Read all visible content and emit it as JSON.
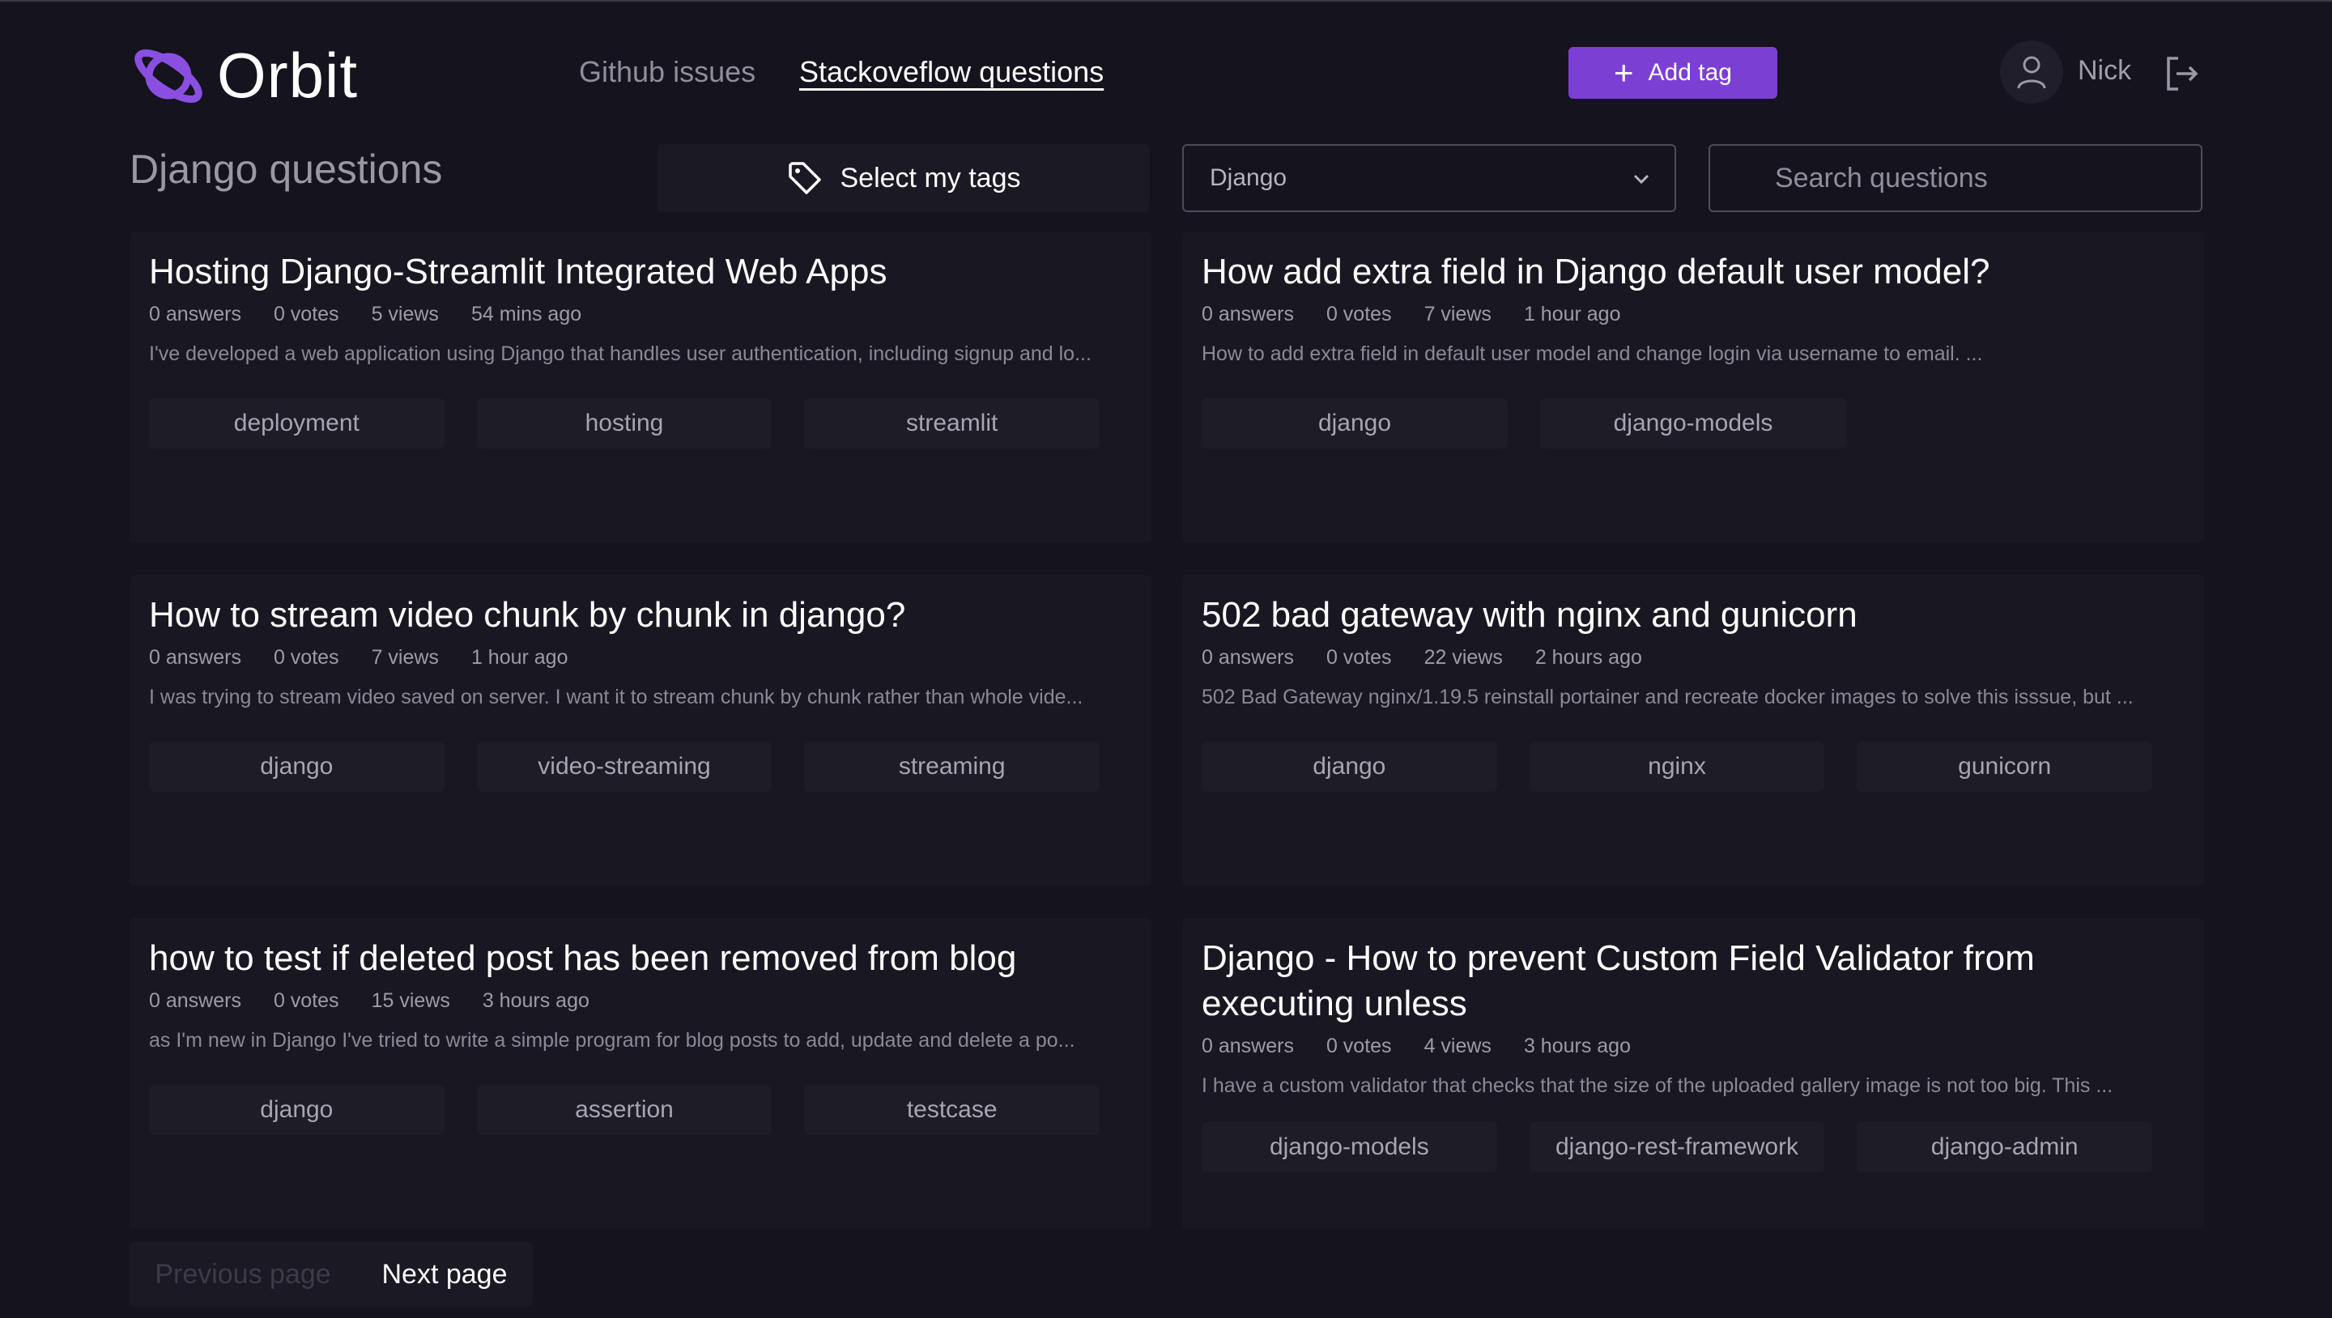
{
  "brand": {
    "name": "Orbit"
  },
  "nav": {
    "github": "Github issues",
    "stackoverflow": "Stackoveflow questions"
  },
  "header": {
    "add_tag": "Add tag",
    "user": "Nick"
  },
  "toolbar": {
    "title": "Django questions",
    "select_tags": "Select my tags",
    "tag_select_value": "Django",
    "search_placeholder": "Search questions"
  },
  "questions": [
    {
      "title": "Hosting Django-Streamlit Integrated Web Apps",
      "answers": "0 answers",
      "votes": "0 votes",
      "views": "5 views",
      "time": "54 mins ago",
      "excerpt": "I've developed a web application using Django that handles user authentication, including signup and lo...",
      "tags": [
        "deployment",
        "hosting",
        "streamlit"
      ]
    },
    {
      "title": "How add extra field in Django default user model?",
      "answers": "0 answers",
      "votes": "0 votes",
      "views": "7 views",
      "time": "1 hour ago",
      "excerpt": "How to add extra field in default user model and change login via username to email. ...",
      "tags": [
        "django",
        "django-models"
      ]
    },
    {
      "title": "How to stream video chunk by chunk in django?",
      "answers": "0 answers",
      "votes": "0 votes",
      "views": "7 views",
      "time": "1 hour ago",
      "excerpt": "I was trying to stream video saved on server. I want it to stream chunk by chunk rather than whole vide...",
      "tags": [
        "django",
        "video-streaming",
        "streaming"
      ]
    },
    {
      "title": "502 bad gateway with nginx and gunicorn",
      "answers": "0 answers",
      "votes": "0 votes",
      "views": "22 views",
      "time": "2 hours ago",
      "excerpt": "502 Bad Gateway nginx/1.19.5 reinstall portainer and recreate docker images to solve this isssue, but ...",
      "tags": [
        "django",
        "nginx",
        "gunicorn"
      ]
    },
    {
      "title": "how to test if deleted post has been removed from blog",
      "answers": "0 answers",
      "votes": "0 votes",
      "views": "15 views",
      "time": "3 hours ago",
      "excerpt": "as I'm new in Django I've tried to write a simple program for blog posts to add, update and delete a po...",
      "tags": [
        "django",
        "assertion",
        "testcase"
      ]
    },
    {
      "title": "Django - How to prevent Custom Field Validator from executing unless",
      "answers": "0 answers",
      "votes": "0 votes",
      "views": "4 views",
      "time": "3 hours ago",
      "excerpt": "I have a custom validator that checks that the size of the uploaded gallery image is not too big. This ...",
      "tags": [
        "django-models",
        "django-rest-framework",
        "django-admin"
      ]
    }
  ],
  "pagination": {
    "previous": "Previous page",
    "next": "Next page"
  },
  "colors": {
    "accent": "#7c3fd4",
    "background": "#14131e",
    "card": "#191822"
  }
}
